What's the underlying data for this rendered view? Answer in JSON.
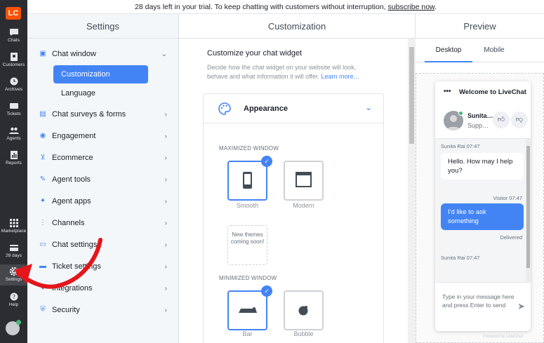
{
  "banner": {
    "text": "28 days left in your trial. To keep chatting with customers without interruption, ",
    "link": "subscribe now",
    "end": "."
  },
  "rail": {
    "logo": "LC",
    "top": [
      {
        "label": "Chats",
        "icon": "chat-icon"
      },
      {
        "label": "Customers",
        "icon": "customers-icon"
      },
      {
        "label": "Archives",
        "icon": "clock-icon"
      },
      {
        "label": "Tickets",
        "icon": "ticket-icon"
      },
      {
        "label": "Agents",
        "icon": "agents-icon"
      },
      {
        "label": "Reports",
        "icon": "reports-icon"
      }
    ],
    "bottom": [
      {
        "label": "Marketplace",
        "icon": "grid-icon"
      },
      {
        "label": "28 days",
        "icon": "card-icon"
      },
      {
        "label": "Settings",
        "icon": "gear-icon"
      },
      {
        "label": "Help",
        "icon": "help-icon"
      }
    ]
  },
  "settings": {
    "title": "Settings",
    "chat_window": "Chat window",
    "customization": "Customization",
    "language": "Language",
    "items": [
      {
        "label": "Chat surveys & forms",
        "icon": "form-icon"
      },
      {
        "label": "Engagement",
        "icon": "eye-icon"
      },
      {
        "label": "Ecommerce",
        "icon": "cart-icon"
      },
      {
        "label": "Agent tools",
        "icon": "wrench-icon"
      },
      {
        "label": "Agent apps",
        "icon": "apps-icon"
      },
      {
        "label": "Channels",
        "icon": "channels-icon"
      },
      {
        "label": "Chat settings",
        "icon": "chat-settings-icon"
      },
      {
        "label": "Ticket settings",
        "icon": "ticket-settings-icon"
      },
      {
        "label": "Integrations",
        "icon": "integrations-icon"
      },
      {
        "label": "Security",
        "icon": "shield-icon"
      }
    ]
  },
  "customization": {
    "title": "Customization",
    "heading": "Customize your chat widget",
    "desc": "Decide how the chat widget on your website will look, behave and what information it will offer. ",
    "learn_more": "Learn more…",
    "appearance": "Appearance",
    "maximized": "MAXIMIZED WINDOW",
    "smooth": "Smooth",
    "modern": "Modern",
    "new_themes": "New themes coming soon!",
    "minimized": "MINIMIZED WINDOW",
    "bar": "Bar",
    "bubble": "Bubble"
  },
  "preview": {
    "title": "Preview",
    "tab_desktop": "Desktop",
    "tab_mobile": "Mobile",
    "widget_title": "Welcome to LiveChat",
    "agent_name": "Sunita…",
    "agent_role": "Supp…",
    "meta1": "Sunita Rai 07:47",
    "msg1": "Hello. How may I help you?",
    "meta2": "Visitor 07:47",
    "msg2": "I'd like to ask something",
    "delivered": "Delivered",
    "meta3": "Sunita Rai 07:47",
    "input_placeholder": "Type in your message here and press Enter to send",
    "powered": "Powered by LiveChat"
  },
  "colors": {
    "accent": "#4384f5",
    "rail": "#2b2d33",
    "annotation": "#e3161b"
  }
}
